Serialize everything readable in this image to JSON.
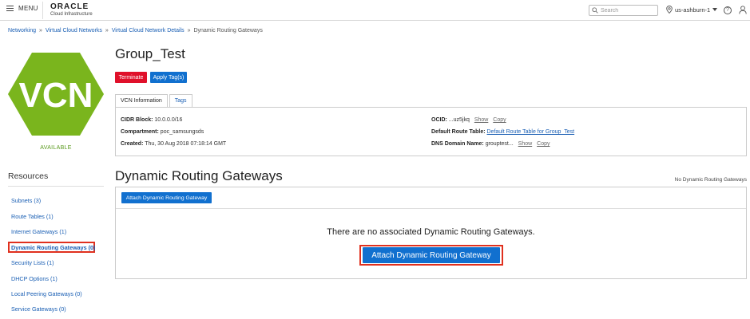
{
  "header": {
    "menu_label": "MENU",
    "brand": "ORACLE",
    "brand_sub": "Cloud Infrastructure",
    "search_placeholder": "Search",
    "region": "us-ashburn-1"
  },
  "breadcrumb": {
    "items": [
      "Networking",
      "Virtual Cloud Networks",
      "Virtual Cloud Network Details"
    ],
    "current": "Dynamic Routing Gateways",
    "separator": "»"
  },
  "vcn": {
    "badge_text": "VCN",
    "badge_color": "#7ab51d",
    "status": "AVAILABLE",
    "status_color": "#5a9a1e"
  },
  "resources": {
    "title": "Resources",
    "items": [
      {
        "label": "Subnets (3)"
      },
      {
        "label": "Route Tables (1)"
      },
      {
        "label": "Internet Gateways (1)"
      },
      {
        "label": "Dynamic Routing Gateways (0)",
        "active": true
      },
      {
        "label": "Security Lists (1)"
      },
      {
        "label": "DHCP Options (1)"
      },
      {
        "label": "Local Peering Gateways (0)"
      },
      {
        "label": "Service Gateways (0)"
      }
    ]
  },
  "main": {
    "title": "Group_Test",
    "terminate_label": "Terminate",
    "apply_tags_label": "Apply Tag(s)",
    "tabs": [
      {
        "label": "VCN Information",
        "active": true
      },
      {
        "label": "Tags",
        "active": false
      }
    ],
    "info": {
      "cidr_label": "CIDR Block:",
      "cidr_value": "10.0.0.0/16",
      "compartment_label": "Compartment:",
      "compartment_value": "poc_samsungsds",
      "created_label": "Created:",
      "created_value": "Thu, 30 Aug 2018 07:18:14 GMT",
      "ocid_label": "OCID:",
      "ocid_value": "...uz5jkq",
      "show_label": "Show",
      "copy_label": "Copy",
      "route_table_label": "Default Route Table:",
      "route_table_value": "Default Route Table for Group_Test",
      "dns_label": "DNS Domain Name:",
      "dns_value": "grouptest..."
    }
  },
  "drg": {
    "title": "Dynamic Routing Gateways",
    "right_note": "No Dynamic Routing Gateways",
    "attach_small_label": "Attach Dynamic Routing Gateway",
    "empty_message": "There are no associated Dynamic Routing Gateways.",
    "attach_big_label": "Attach Dynamic Routing Gateway"
  },
  "colors": {
    "link": "#1a5fb4",
    "primary": "#1170cf",
    "danger": "#e0102a",
    "highlight": "#e0301e"
  }
}
